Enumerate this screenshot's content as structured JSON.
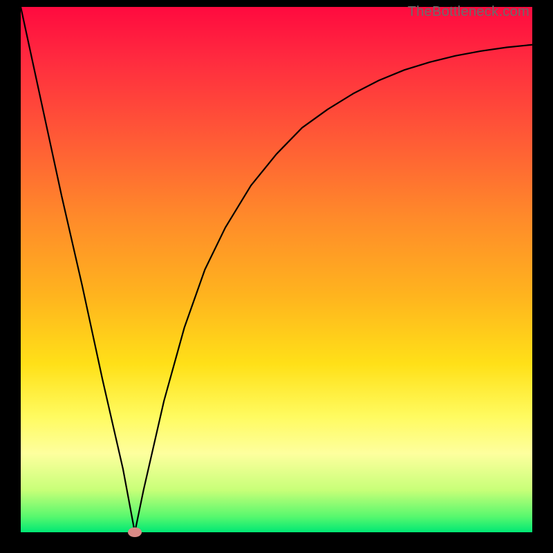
{
  "watermark": "TheBottleneck.com",
  "chart_data": {
    "type": "line",
    "title": "",
    "xlabel": "",
    "ylabel": "",
    "xlim": [
      0,
      100
    ],
    "ylim": [
      0,
      100
    ],
    "grid": false,
    "legend": false,
    "background": "rainbow-vertical",
    "series": [
      {
        "name": "bottleneck-curve",
        "color": "#000000",
        "x": [
          0,
          4,
          8,
          12,
          16,
          20,
          22.3,
          24,
          28,
          32,
          36,
          40,
          45,
          50,
          55,
          60,
          65,
          70,
          75,
          80,
          85,
          90,
          95,
          100
        ],
        "y": [
          100,
          82,
          64,
          47,
          29,
          12,
          0,
          8,
          25,
          39,
          50,
          58,
          66,
          72,
          77,
          80.5,
          83.5,
          86,
          88,
          89.5,
          90.7,
          91.6,
          92.3,
          92.8
        ]
      }
    ],
    "marker": {
      "x": 22.3,
      "y": 0,
      "color": "#d98a86"
    }
  }
}
